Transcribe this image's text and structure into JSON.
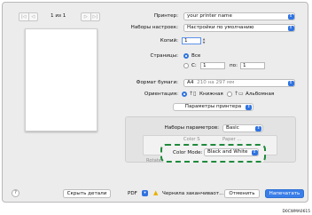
{
  "preview": {
    "page_counter": "1 из 1",
    "first_label": "|◁",
    "prev_label": "◁",
    "next_label": "▷",
    "last_label": "▷|"
  },
  "printer": {
    "label": "Принтер:",
    "value": "your printer name"
  },
  "presets": {
    "label": "Наборы настроек:",
    "value": "Настройки по умолчанию"
  },
  "copies": {
    "label": "Копий:",
    "value": "1"
  },
  "pages": {
    "label": "Страницы:",
    "all_label": "Все",
    "from_label": "С:",
    "from_value": "1",
    "to_label": "по:",
    "to_value": "1",
    "selected": "all"
  },
  "paper": {
    "label": "Формат бумаги:",
    "value": "A4",
    "size_hint": "210 на 297 мм"
  },
  "orientation": {
    "label": "Ориентация:",
    "portrait_label": "Книжная",
    "landscape_label": "Альбомная",
    "selected": "portrait"
  },
  "section": {
    "value": "Параметры принтера"
  },
  "param_sets": {
    "label": "Наборы параметров:",
    "value": "Basic"
  },
  "ghost_text": {
    "left": "Rotate",
    "mid": "Color S",
    "right": "Paper ..."
  },
  "color_mode": {
    "label": "Color Mode:",
    "value": "Black and White"
  },
  "bottom": {
    "help_label": "?",
    "hide_details_label": "Скрыть детали",
    "pdf_label": "PDF",
    "warning_text": "Чернила заканчиваот...",
    "cancel_label": "Отменить",
    "print_label": "Напечатать"
  },
  "figure_code": "D0CWMA0615",
  "colors": {
    "accent": "#2f73e0",
    "callout": "#1f8a3c",
    "warning": "#e9b000"
  }
}
